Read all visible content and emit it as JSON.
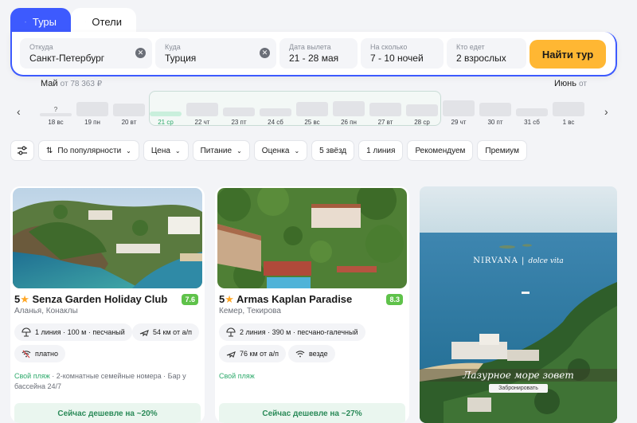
{
  "tabs": [
    {
      "label": "Туры",
      "icon": "airplane-icon",
      "active": true
    },
    {
      "label": "Отели",
      "icon": "bed-icon",
      "active": false
    }
  ],
  "search": {
    "from": {
      "label": "Откуда",
      "value": "Санкт-Петербург"
    },
    "to": {
      "label": "Куда",
      "value": "Турция"
    },
    "dates": {
      "label": "Дата вылета",
      "value": "21 - 28 мая"
    },
    "nights": {
      "label": "На сколько",
      "value": "7 - 10 ночей"
    },
    "guests": {
      "label": "Кто едет",
      "value": "2 взрослых"
    },
    "button": "Найти тур"
  },
  "calendar": {
    "month_may": "Май",
    "month_may_price": "от 78 363 ₽",
    "month_june": "Июнь",
    "month_june_price": "от",
    "unknown_mark": "?",
    "days": [
      {
        "label": "18 вс",
        "level": 0.2,
        "selected": false
      },
      {
        "label": "19 пн",
        "level": 0.9,
        "selected": false
      },
      {
        "label": "20 вт",
        "level": 0.8,
        "selected": false
      },
      {
        "label": "21 ср",
        "level": 0.3,
        "selected": true
      },
      {
        "label": "22 чт",
        "level": 0.85,
        "selected": false
      },
      {
        "label": "23 пт",
        "level": 0.55,
        "selected": false
      },
      {
        "label": "24 сб",
        "level": 0.5,
        "selected": false
      },
      {
        "label": "25 вс",
        "level": 0.9,
        "selected": false
      },
      {
        "label": "26 пн",
        "level": 0.95,
        "selected": false
      },
      {
        "label": "27 вт",
        "level": 0.85,
        "selected": false
      },
      {
        "label": "28 ср",
        "level": 0.75,
        "selected": false
      },
      {
        "label": "29 чт",
        "level": 1.0,
        "selected": false
      },
      {
        "label": "30 пт",
        "level": 0.85,
        "selected": false
      },
      {
        "label": "31 сб",
        "level": 0.5,
        "selected": false
      },
      {
        "label": "1 вс",
        "level": 0.9,
        "selected": false
      }
    ]
  },
  "filters": {
    "sort": "По популярности",
    "price": "Цена",
    "food": "Питание",
    "rating": "Оценка",
    "stars5": "5 звёзд",
    "line1": "1 линия",
    "recommend": "Рекомендуем",
    "premium": "Премиум"
  },
  "hotels": [
    {
      "stars": "5",
      "name": "Senza Garden Holiday Club",
      "rating": "7.6",
      "location": "Аланья, Конаклы",
      "beach": "1 линия · 100 м · песчаный",
      "airport": "54 км от а/п",
      "wifi": "платно",
      "own_beach": "Свой пляж",
      "extra": " · 2-комнатные семейные номера · Бар у бассейна 24/7",
      "deal": "Сейчас дешевле на ~20%"
    },
    {
      "stars": "5",
      "name": "Armas Kaplan Paradise",
      "rating": "8.3",
      "location": "Кемер, Текирова",
      "beach": "2 линия · 390 м · песчано-галечный",
      "airport": "76 км от а/п",
      "wifi": "везде",
      "own_beach": "Свой пляж",
      "extra": "",
      "deal": "Сейчас дешевле на ~27%"
    }
  ],
  "ad": {
    "brand": "NIRVANA",
    "brand_sub": "dolce vita",
    "title": "Лазурное море зовет",
    "button": "Забронировать"
  }
}
